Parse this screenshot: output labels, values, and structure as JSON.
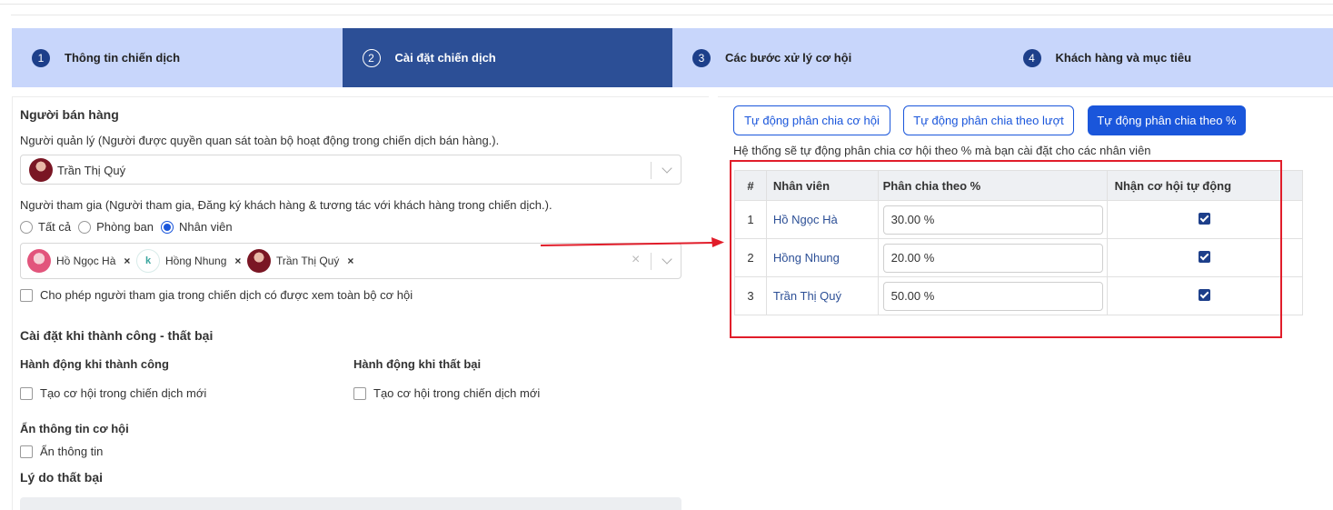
{
  "steps": [
    {
      "num": "1",
      "label": "Thông tin chiến dịch",
      "active": false
    },
    {
      "num": "2",
      "label": "Cài đặt chiến dịch",
      "active": true
    },
    {
      "num": "3",
      "label": "Các bước xử lý cơ hội",
      "active": false
    },
    {
      "num": "4",
      "label": "Khách hàng và mục tiêu",
      "active": false
    }
  ],
  "sales": {
    "title": "Người bán hàng",
    "manager_label": "Người quản lý (Người được quyền quan sát toàn bộ hoạt động trong chiến dịch bán hàng.).",
    "manager_value": "Trần Thị Quý",
    "participant_label": "Người tham gia (Người tham gia, Đăng ký khách hàng & tương tác với khách hàng trong chiến dịch.).",
    "radios": [
      "Tất cả",
      "Phòng ban",
      "Nhân viên"
    ],
    "selected_radio": "Nhân viên",
    "chips": [
      {
        "name": "Hồ Ngọc Hà",
        "x_icon": "×"
      },
      {
        "name": "Hồng Nhung",
        "x_icon": "×"
      },
      {
        "name": "Trần Thị Quý",
        "x_icon": "×"
      }
    ],
    "clear_icon": "×",
    "allow_view_label": "Cho phép người tham gia trong chiến dịch có được xem toàn bộ cơ hội"
  },
  "outcome": {
    "title": "Cài đặt khi thành công - thất bại",
    "success_title": "Hành động khi thành công",
    "success_option": "Tạo cơ hội trong chiến dịch mới",
    "fail_title": "Hành động khi thất bại",
    "fail_option": "Tạo cơ hội trong chiến dịch mới",
    "hide_title": "Ẩn thông tin cơ hội",
    "hide_option": "Ẩn thông tin",
    "reason_title": "Lý do thất bại"
  },
  "distribution": {
    "buttons": [
      "Tự động phân chia cơ hội",
      "Tự động phân chia theo lượt",
      "Tự động phân chia theo %"
    ],
    "active_button": "Tự động phân chia theo %",
    "description": "Hệ thống sẽ tự động phân chia cơ hội theo % mà bạn cài đặt cho các nhân viên",
    "columns": [
      "#",
      "Nhân viên",
      "Phân chia theo %",
      "Nhận cơ hội tự động"
    ],
    "rows": [
      {
        "idx": "1",
        "name": "Hồ Ngọc Hà",
        "percent": "30.00 %",
        "auto": true
      },
      {
        "idx": "2",
        "name": "Hồng Nhung",
        "percent": "20.00 %",
        "auto": true
      },
      {
        "idx": "3",
        "name": "Trần Thị Quý",
        "percent": "50.00 %",
        "auto": true
      }
    ]
  },
  "colors": {
    "primary": "#1a56db",
    "step_bg": "#c8d6fb",
    "step_active": "#2c4f96",
    "highlight": "#e11d2a"
  }
}
